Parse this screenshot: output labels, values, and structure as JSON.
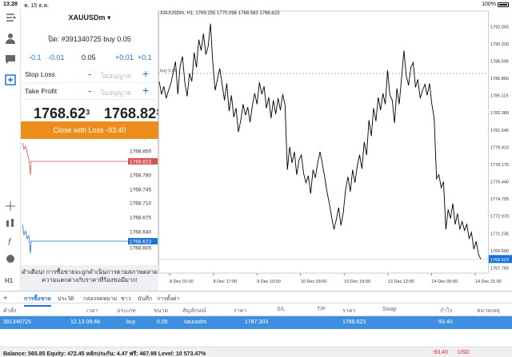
{
  "status": {
    "time": "13:28",
    "date": "พ. 15 ธ.ค.",
    "battery": "100%"
  },
  "order": {
    "symbol": "XAUUSDm",
    "ticket_line": "ปิด: #391340725 buy 0.05",
    "vol": [
      "-0.1",
      "-0.01",
      "0.05",
      "+0.01",
      "+0.1"
    ],
    "stop_loss": {
      "label": "Stop Loss",
      "placeholder": "ไม่อนุญาต"
    },
    "take_profit": {
      "label": "Take Profit",
      "placeholder": "ไม่อนุญาต"
    },
    "bid": {
      "main": "1768.62",
      "sup": "3"
    },
    "ask": {
      "main": "1768.82",
      "sup": "3"
    },
    "close_label": "Close with Loss -93.40",
    "mini_prices": [
      "1768.850",
      "1768.823",
      "1768.780",
      "1768.745",
      "1768.710",
      "1768.675",
      "1768.640",
      "1768.623",
      "1768.605"
    ],
    "warning": "คำเตือน! การซื้อขายจะถูกดำเนินการตามสภาพตลาด ความแตกต่างกับราคาที่ร้องขอมีมาก!"
  },
  "chart": {
    "title": "XAUUSDm, H1, 1769.255 1770.096 1768.583 1768.623",
    "buy_label": "buy 0.05",
    "colors": {
      "line": "#000000",
      "current": "#1a73d9",
      "grid": "#eeeeee"
    }
  },
  "chart_data": {
    "type": "line",
    "title": "XAUUSDm, H1, 1769.255 1770.096 1768.583 1768.623",
    "x": [
      "8 Dec 01:00",
      "8 Dec 17:00",
      "9 Dec 10:00",
      "10 Dec 03:00",
      "10 Dec 19:00",
      "13 Dec 12:00",
      "14 Dec 05:00",
      "14 Dec 21:00"
    ],
    "y_ticks": [
      "1792.055",
      "1790.320",
      "1788.595",
      "1786.850",
      "1785.115",
      "1783.380",
      "1781.645",
      "1779.910",
      "1778.175",
      "1776.440",
      "1774.705",
      "1772.970",
      "1771.235",
      "1769.500",
      "1768.623",
      "1767.765"
    ],
    "ylim": [
      1767.2,
      1792.6
    ],
    "buy_price": 1787.303,
    "current_price": 1768.623,
    "series": [
      {
        "values": [
          1786.5,
          1785.2,
          1786.0,
          1784.8,
          1785.6,
          1786.3,
          1787.4,
          1788.5,
          1785.2,
          1788.1,
          1789.0,
          1786.4,
          1785.0,
          1787.3,
          1786.5,
          1789.4,
          1787.9,
          1790.7,
          1789.6,
          1791.3,
          1789.2,
          1790.0,
          1792.3,
          1788.4,
          1785.6,
          1786.7,
          1787.8,
          1786.2,
          1784.6,
          1786.3,
          1783.5,
          1785.1,
          1782.9,
          1783.8,
          1781.4,
          1782.6,
          1784.2,
          1783.1,
          1783.9,
          1782.4,
          1784.1,
          1785.3,
          1784.2,
          1786.4,
          1785.2,
          1786.0,
          1783.8,
          1784.9,
          1782.8,
          1784.6,
          1783.2,
          1784.8,
          1783.6,
          1785.2,
          1784.1,
          1777.6,
          1779.9,
          1778.3,
          1779.4,
          1777.1,
          1778.6,
          1779.1,
          1777.2,
          1776.3,
          1777.0,
          1775.2,
          1777.6,
          1776.8,
          1778.3,
          1779.4,
          1778.2,
          1776.9,
          1775.4,
          1774.2,
          1772.8,
          1771.6,
          1772.6,
          1773.8,
          1772.0,
          1773.3,
          1775.6,
          1776.9,
          1775.4,
          1777.6,
          1776.3,
          1778.0,
          1779.1,
          1777.7,
          1780.4,
          1779.1,
          1782.6,
          1781.0,
          1783.8,
          1782.5,
          1784.9,
          1783.6,
          1785.3,
          1784.2,
          1787.6,
          1785.1,
          1784.6,
          1782.3,
          1785.8,
          1784.2,
          1786.9,
          1789.6,
          1787.1,
          1786.1,
          1787.9,
          1788.4,
          1785.9,
          1786.7,
          1784.8,
          1785.6,
          1786.2,
          1785.1,
          1786.3,
          1784.2,
          1782.8,
          1776.7,
          1777.1,
          1775.8,
          1776.4,
          1771.6,
          1773.6,
          1772.7,
          1774.2,
          1772.1,
          1773.2,
          1771.6,
          1772.4,
          1771.5,
          1772.1,
          1770.7,
          1771.3,
          1769.6,
          1770.4,
          1769.1,
          1768.6
        ]
      }
    ]
  },
  "tabs": [
    "การซื้อขาย",
    "ประวัติ",
    "กล่องจดหมาย",
    "ข่าว",
    "บันทึก",
    "การตั้งค่า"
  ],
  "columns": [
    "คำสั่ง",
    "เวลา",
    "ประเภท",
    "ขนาด",
    "สัญลักษณ์",
    "ราคา",
    "S/L",
    "T/P",
    "ราคา",
    "Swap",
    "กำไร",
    "หมายเหตุ"
  ],
  "trade": {
    "ticket": "391340725",
    "time": "12.13 08:48",
    "type": "buy",
    "size": "0.05",
    "symbol": "xauusdm",
    "price": "1787.303",
    "cur_price": "1768.623",
    "profit": "-93.40"
  },
  "balance": {
    "text": "Balance: 565.85 Equity: 472.45 หลักประกัน: 4.47 ฟรี: 467.98 Level: 10 573.47%",
    "profit": "-93.40",
    "currency": "USD"
  }
}
